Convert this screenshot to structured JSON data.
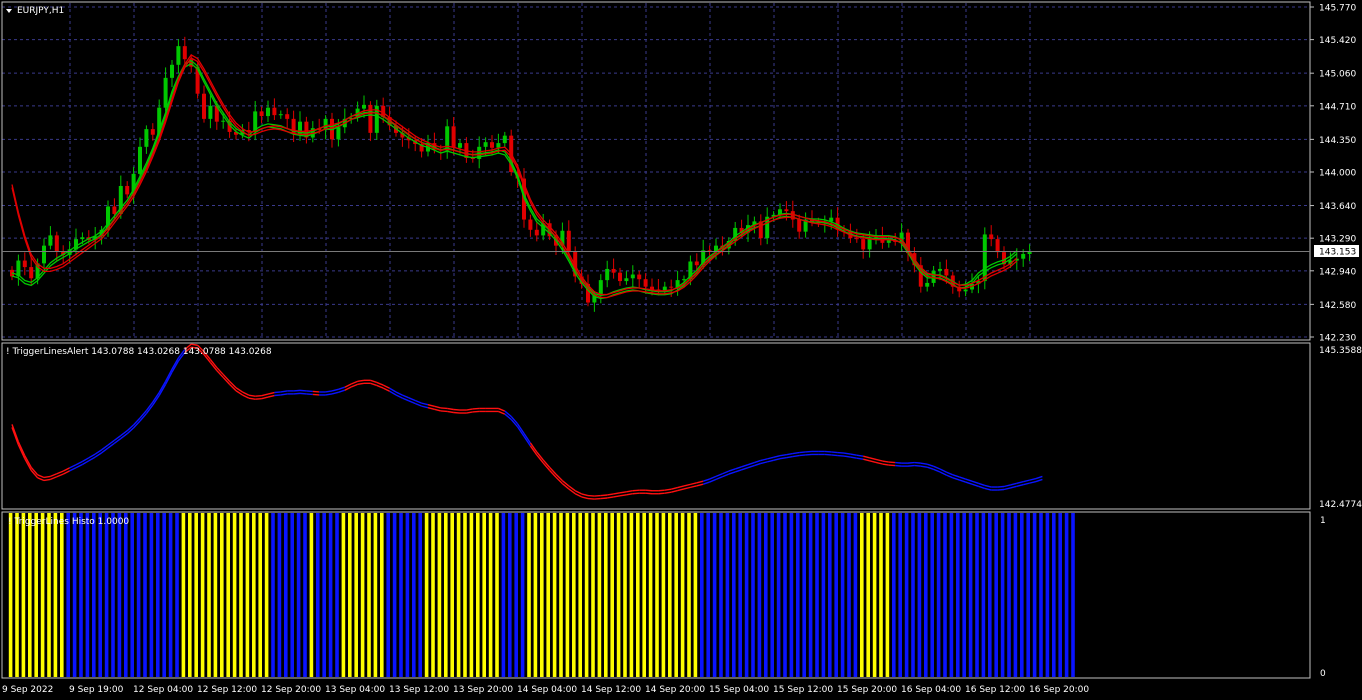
{
  "main_panel": {
    "symbol_label": "EURJPY,H1",
    "price_ticks": [
      "145.770",
      "145.420",
      "145.060",
      "144.710",
      "144.350",
      "144.000",
      "143.640",
      "143.290",
      "142.940",
      "142.580",
      "142.230"
    ],
    "current_price": "143.153"
  },
  "indicator_panel": {
    "label": "! TriggerLinesAlert 143.0788 143.0268 143.0788 143.0268",
    "scale_top": "145.3588",
    "scale_bottom": "142.4774"
  },
  "histo_panel": {
    "label": "! TriggerLines Histo  1.0000",
    "scale_top": "1",
    "scale_bottom": "0"
  },
  "time_axis": {
    "labels": [
      "9 Sep 2022",
      "9 Sep 19:00",
      "12 Sep 04:00",
      "12 Sep 12:00",
      "12 Sep 20:00",
      "13 Sep 04:00",
      "13 Sep 12:00",
      "13 Sep 20:00",
      "14 Sep 04:00",
      "14 Sep 12:00",
      "14 Sep 20:00",
      "15 Sep 04:00",
      "15 Sep 12:00",
      "15 Sep 20:00",
      "16 Sep 04:00",
      "16 Sep 12:00",
      "16 Sep 20:00"
    ]
  },
  "colors": {
    "background": "#000000",
    "bull": "#00c800",
    "bear": "#e00000",
    "grid": "#3a3a8c",
    "trigger_up": "#0a14ff",
    "trigger_down": "#ff1010",
    "histo_up": "#0a14ff",
    "histo_down": "#ffff00"
  },
  "chart_data": [
    {
      "type": "candlestick",
      "title": "EURJPY,H1",
      "ylim": [
        142.23,
        145.77
      ],
      "close": [
        142.88,
        143.05,
        142.98,
        142.86,
        143.02,
        143.21,
        143.32,
        143.15,
        143.11,
        143.17,
        143.28,
        143.3,
        143.27,
        143.31,
        143.38,
        143.63,
        143.55,
        143.85,
        143.76,
        143.98,
        144.27,
        144.46,
        144.4,
        144.69,
        145.01,
        145.15,
        145.35,
        145.21,
        145.13,
        144.84,
        144.57,
        144.71,
        144.54,
        144.55,
        144.43,
        144.4,
        144.45,
        144.43,
        144.65,
        144.6,
        144.69,
        144.61,
        144.62,
        144.57,
        144.41,
        144.54,
        144.37,
        144.47,
        144.45,
        144.57,
        144.35,
        144.48,
        144.57,
        144.58,
        144.68,
        144.72,
        144.42,
        144.71,
        144.59,
        144.5,
        144.42,
        144.37,
        144.34,
        144.3,
        144.22,
        144.31,
        144.24,
        144.23,
        144.49,
        144.26,
        144.31,
        144.15,
        144.14,
        144.27,
        144.32,
        144.26,
        144.31,
        144.39,
        144.0,
        143.93,
        143.49,
        143.38,
        143.32,
        143.45,
        143.31,
        143.21,
        143.37,
        143.15,
        142.88,
        142.8,
        142.6,
        142.68,
        142.84,
        142.96,
        142.92,
        142.83,
        142.86,
        142.9,
        142.85,
        142.77,
        142.74,
        142.73,
        142.77,
        142.76,
        142.84,
        142.85,
        143.04,
        143.0,
        143.16,
        143.15,
        143.21,
        143.18,
        143.26,
        143.4,
        143.35,
        143.43,
        143.47,
        143.29,
        143.52,
        143.54,
        143.6,
        143.58,
        143.49,
        143.36,
        143.49,
        143.47,
        143.45,
        143.47,
        143.51,
        143.38,
        143.37,
        143.29,
        143.28,
        143.17,
        143.3,
        143.3,
        143.24,
        143.27,
        143.25,
        143.35,
        143.13,
        143.0,
        142.77,
        142.81,
        142.94,
        142.96,
        142.89,
        142.77,
        142.72,
        142.74,
        142.8,
        142.83,
        143.33,
        143.28,
        143.14,
        143.01,
        143.05,
        143.07,
        143.12,
        143.15
      ],
      "ma_green": [
        142.9,
        142.88,
        142.82,
        142.8,
        142.85,
        142.93,
        143.01,
        143.06,
        143.1,
        143.14,
        143.19,
        143.23,
        143.27,
        143.3,
        143.35,
        143.43,
        143.51,
        143.6,
        143.68,
        143.8,
        143.94,
        144.08,
        144.24,
        144.43,
        144.62,
        144.85,
        145.01,
        145.14,
        145.18,
        145.12,
        144.98,
        144.85,
        144.72,
        144.62,
        144.52,
        144.45,
        144.41,
        144.38,
        144.44,
        144.48,
        144.5,
        144.49,
        144.48,
        144.45,
        144.42,
        144.41,
        144.4,
        144.42,
        144.45,
        144.48,
        144.47,
        144.5,
        144.54,
        144.58,
        144.6,
        144.62,
        144.63,
        144.62,
        144.58,
        144.53,
        144.48,
        144.43,
        144.38,
        144.34,
        144.3,
        144.28,
        144.25,
        144.22,
        144.24,
        144.22,
        144.2,
        144.18,
        144.17,
        144.18,
        144.19,
        144.2,
        144.22,
        144.2,
        144.1,
        143.95,
        143.74,
        143.6,
        143.48,
        143.42,
        143.36,
        143.28,
        143.18,
        143.06,
        142.93,
        142.83,
        142.75,
        142.68,
        142.66,
        142.67,
        142.7,
        142.72,
        142.74,
        142.75,
        142.74,
        142.72,
        142.71,
        142.7,
        142.7,
        142.71,
        142.75,
        142.8,
        142.87,
        142.93,
        143.02,
        143.08,
        143.13,
        143.18,
        143.23,
        143.3,
        143.34,
        143.39,
        143.42,
        143.44,
        143.47,
        143.5,
        143.53,
        143.54,
        143.53,
        143.51,
        143.49,
        143.48,
        143.48,
        143.47,
        143.45,
        143.42,
        143.38,
        143.35,
        143.33,
        143.32,
        143.31,
        143.3,
        143.3,
        143.3,
        143.29,
        143.25,
        143.15,
        143.03,
        142.94,
        142.88,
        142.88,
        142.88,
        142.85,
        142.81,
        142.77,
        142.78,
        142.82,
        142.9,
        142.95,
        142.99,
        143.02,
        143.04,
        143.08,
        143.14
      ],
      "ma_red": [
        143.85,
        143.55,
        143.3,
        143.1,
        143.0,
        142.95,
        142.95,
        142.97,
        143.0,
        143.05,
        143.1,
        143.15,
        143.2,
        143.25,
        143.3,
        143.38,
        143.47,
        143.56,
        143.65,
        143.75,
        143.88,
        144.02,
        144.18,
        144.35,
        144.55,
        144.77,
        144.98,
        145.14,
        145.24,
        145.2,
        145.09,
        144.96,
        144.83,
        144.71,
        144.6,
        144.51,
        144.45,
        144.41,
        144.42,
        144.45,
        144.47,
        144.48,
        144.47,
        144.45,
        144.43,
        144.42,
        144.42,
        144.43,
        144.45,
        144.48,
        144.49,
        144.51,
        144.54,
        144.58,
        144.61,
        144.64,
        144.65,
        144.65,
        144.62,
        144.57,
        144.52,
        144.47,
        144.42,
        144.37,
        144.33,
        144.3,
        144.27,
        144.25,
        144.26,
        144.25,
        144.23,
        144.21,
        144.2,
        144.2,
        144.21,
        144.22,
        144.24,
        144.25,
        144.18,
        144.05,
        143.86,
        143.69,
        143.56,
        143.47,
        143.4,
        143.32,
        143.22,
        143.11,
        142.98,
        142.86,
        142.77,
        142.7,
        142.67,
        142.67,
        142.69,
        142.71,
        142.73,
        142.74,
        142.74,
        142.73,
        142.72,
        142.71,
        142.71,
        142.72,
        142.74,
        142.78,
        142.84,
        142.91,
        142.99,
        143.06,
        143.12,
        143.17,
        143.22,
        143.27,
        143.32,
        143.37,
        143.41,
        143.44,
        143.47,
        143.5,
        143.52,
        143.53,
        143.53,
        143.51,
        143.49,
        143.47,
        143.46,
        143.45,
        143.43,
        143.4,
        143.37,
        143.34,
        143.32,
        143.31,
        143.3,
        143.29,
        143.29,
        143.29,
        143.28,
        143.26,
        143.17,
        143.05,
        142.96,
        142.9,
        142.88,
        142.87,
        142.84,
        142.8,
        142.77,
        142.77,
        142.79,
        142.82,
        142.86,
        142.9,
        142.93,
        142.96,
        143.0,
        143.06
      ]
    },
    {
      "type": "line",
      "title": "! TriggerLinesAlert",
      "ylim": [
        142.4774,
        145.3588
      ],
      "series": [
        {
          "values": [
            143.93,
            143.6,
            143.34,
            143.12,
            142.98,
            142.93,
            142.95,
            143.0,
            143.05,
            143.11,
            143.17,
            143.23,
            143.3,
            143.37,
            143.45,
            143.54,
            143.63,
            143.72,
            143.81,
            143.92,
            144.05,
            144.19,
            144.35,
            144.53,
            144.74,
            144.97,
            145.18,
            145.34,
            145.44,
            145.42,
            145.3,
            145.15,
            145.0,
            144.87,
            144.74,
            144.62,
            144.54,
            144.48,
            144.46,
            144.47,
            144.5,
            144.53,
            144.54,
            144.56,
            144.56,
            144.57,
            144.56,
            144.55,
            144.54,
            144.54,
            144.56,
            144.59,
            144.63,
            144.69,
            144.74,
            144.76,
            144.76,
            144.72,
            144.67,
            144.61,
            144.54,
            144.48,
            144.43,
            144.38,
            144.33,
            144.3,
            144.27,
            144.24,
            144.23,
            144.21,
            144.2,
            144.2,
            144.22,
            144.23,
            144.23,
            144.23,
            144.23,
            144.18,
            144.08,
            143.94,
            143.76,
            143.58,
            143.41,
            143.26,
            143.12,
            142.99,
            142.87,
            142.77,
            142.68,
            142.62,
            142.59,
            142.58,
            142.59,
            142.6,
            142.62,
            142.64,
            142.66,
            142.68,
            142.69,
            142.69,
            142.68,
            142.68,
            142.69,
            142.71,
            142.74,
            142.77,
            142.8,
            142.83,
            142.86,
            142.9,
            142.95,
            143.0,
            143.05,
            143.09,
            143.13,
            143.17,
            143.21,
            143.25,
            143.28,
            143.31,
            143.34,
            143.36,
            143.38,
            143.4,
            143.41,
            143.42,
            143.42,
            143.42,
            143.41,
            143.4,
            143.39,
            143.37,
            143.35,
            143.33,
            143.3,
            143.27,
            143.24,
            143.22,
            143.21,
            143.2,
            143.2,
            143.21,
            143.2,
            143.18,
            143.14,
            143.09,
            143.03,
            142.98,
            142.94,
            142.9,
            142.86,
            142.82,
            142.78,
            142.75,
            142.75,
            142.76,
            142.79,
            142.82,
            142.85,
            142.88,
            142.91,
            142.95
          ]
        }
      ]
    },
    {
      "type": "bar",
      "title": "! TriggerLines Histo",
      "ylim": [
        0,
        1
      ],
      "values": [
        1,
        1,
        1,
        1,
        1,
        1,
        1,
        1,
        1,
        1,
        1,
        1,
        1,
        1,
        1,
        1,
        1,
        1,
        1,
        1,
        1,
        1,
        1,
        1,
        1,
        1,
        1,
        1,
        1,
        1,
        1,
        1,
        1,
        1,
        1,
        1,
        1,
        1,
        1,
        1,
        1,
        1,
        1,
        1,
        1,
        1,
        1,
        1,
        1,
        1,
        1,
        1,
        1,
        1,
        1,
        1,
        1,
        1,
        1,
        1,
        1,
        1,
        1,
        1,
        1,
        1,
        1,
        1,
        1,
        1,
        1,
        1,
        1,
        1,
        1,
        1,
        1,
        1,
        1,
        1,
        1,
        1,
        1,
        1,
        1,
        1,
        1,
        1,
        1,
        1,
        1,
        1,
        1,
        1,
        1,
        1,
        1,
        1,
        1,
        1,
        1,
        1,
        1,
        1,
        1,
        1,
        1,
        1,
        1,
        1,
        1,
        1,
        1,
        1,
        1,
        1,
        1,
        1,
        1,
        1,
        1,
        1,
        1,
        1,
        1,
        1,
        1,
        1,
        1,
        1,
        1,
        1,
        1,
        1,
        1,
        1,
        1,
        1,
        1,
        1,
        1,
        1,
        1,
        1,
        1,
        1,
        1,
        1,
        1,
        1,
        1,
        1,
        1,
        1,
        1,
        1,
        1,
        1,
        1,
        1,
        1,
        1,
        1,
        1,
        1,
        1,
        1
      ],
      "up": [
        0,
        0,
        0,
        0,
        0,
        0,
        0,
        0,
        0,
        1,
        1,
        1,
        1,
        1,
        1,
        1,
        1,
        1,
        1,
        1,
        1,
        1,
        1,
        1,
        1,
        1,
        1,
        0,
        0,
        0,
        0,
        0,
        0,
        0,
        0,
        0,
        0,
        0,
        0,
        0,
        0,
        1,
        1,
        1,
        1,
        1,
        1,
        0,
        1,
        1,
        1,
        1,
        0,
        0,
        0,
        0,
        0,
        0,
        0,
        1,
        1,
        1,
        1,
        1,
        1,
        0,
        0,
        0,
        0,
        0,
        0,
        0,
        0,
        0,
        0,
        0,
        0,
        1,
        1,
        1,
        1,
        0,
        0,
        0,
        0,
        0,
        0,
        0,
        0,
        0,
        0,
        0,
        0,
        0,
        0,
        0,
        0,
        0,
        0,
        0,
        0,
        0,
        0,
        0,
        0,
        0,
        0,
        0,
        1,
        1,
        1,
        1,
        1,
        1,
        1,
        1,
        1,
        1,
        1,
        1,
        1,
        1,
        1,
        1,
        1,
        1,
        1,
        1,
        1,
        1,
        1,
        1,
        1,
        0,
        0,
        0,
        0,
        0,
        1,
        1,
        1,
        1,
        1,
        1,
        1,
        1,
        1,
        1,
        1,
        1,
        1,
        1,
        1,
        1,
        1,
        1,
        1,
        1,
        1,
        1,
        1,
        1,
        1,
        1,
        1,
        1,
        1,
        1,
        1,
        1,
        1,
        1,
        1,
        1,
        1,
        1,
        1,
        1,
        1,
        1,
        1,
        1,
        1,
        1,
        1,
        1,
        1,
        1,
        1,
        1,
        1,
        1,
        1,
        1,
        1,
        1,
        1,
        1
      ]
    }
  ]
}
